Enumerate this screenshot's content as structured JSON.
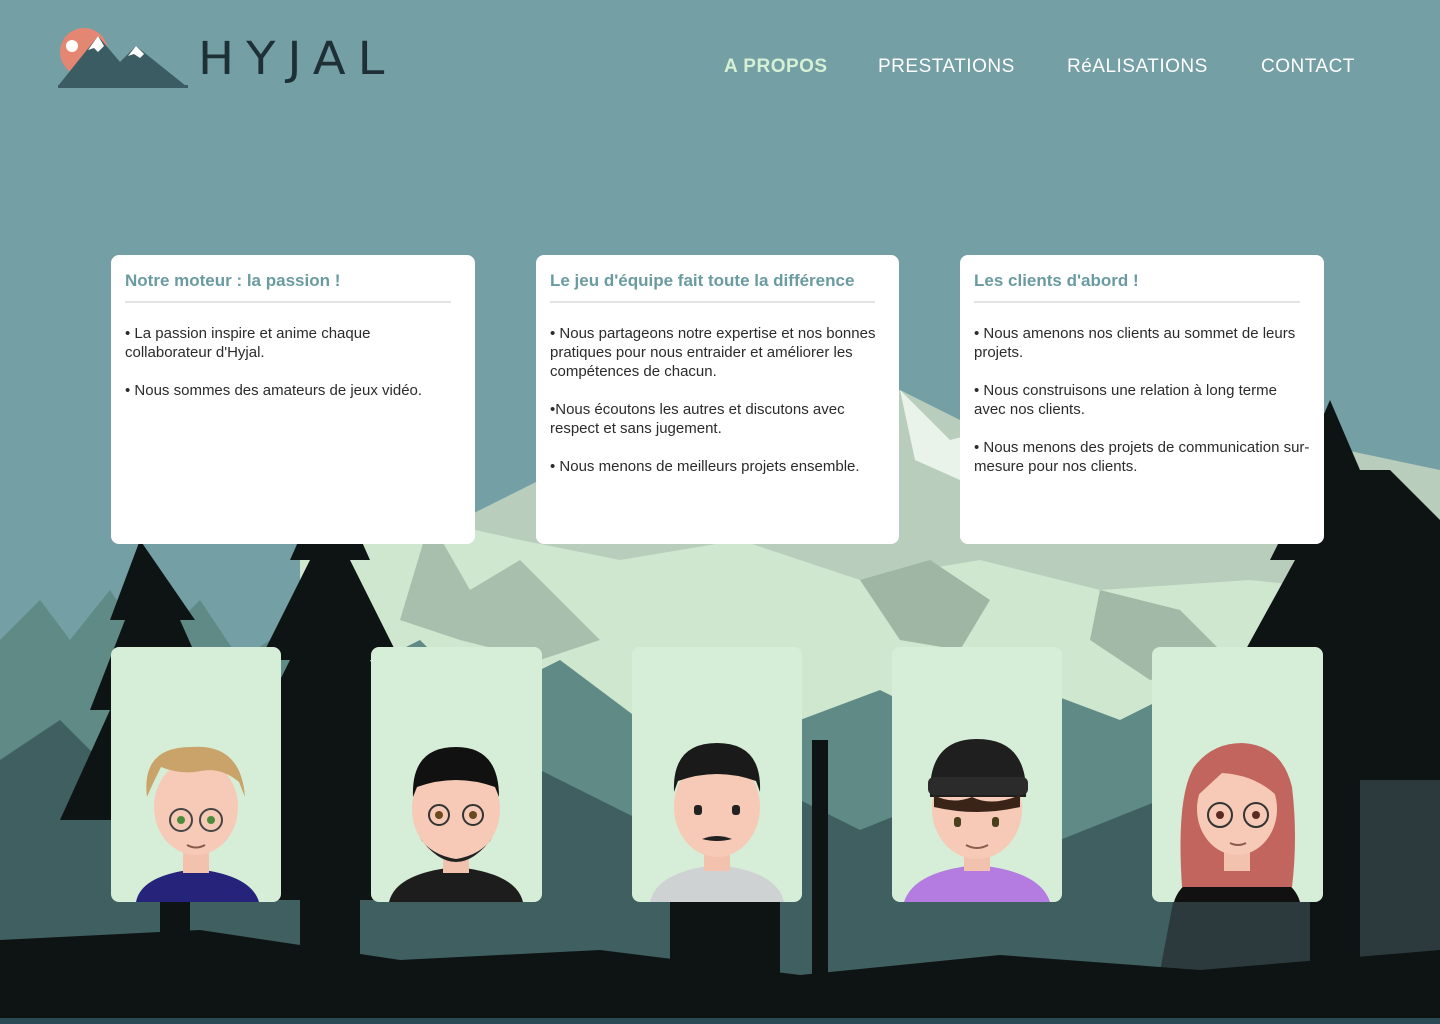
{
  "brand": {
    "name": "HYJAL"
  },
  "nav": {
    "items": [
      {
        "label": "A PROPOS",
        "active": true
      },
      {
        "label": "PRESTATIONS",
        "active": false
      },
      {
        "label": "RéALISATIONS",
        "active": false
      },
      {
        "label": "CONTACT",
        "active": false
      }
    ]
  },
  "values": [
    {
      "title": "Notre moteur : la passion !",
      "lines": [
        "• La passion inspire et anime chaque collaborateur d'Hyjal.",
        "• Nous sommes des amateurs de jeux vidéo."
      ]
    },
    {
      "title": "Le jeu d'équipe fait toute la différence",
      "lines": [
        "• Nous partageons notre expertise et nos bonnes pratiques pour nous entraider et améliorer les compétences de chacun.",
        "•Nous écoutons les autres et discutons avec respect et sans  jugement.",
        "• Nous menons de meilleurs projets ensemble."
      ]
    },
    {
      "title": "Les clients d'abord !",
      "lines": [
        "• Nous amenons nos clients au sommet de leurs projets.",
        "• Nous construisons une relation à long terme avec nos clients.",
        "• Nous menons des projets de communication sur-mesure pour nos clients."
      ]
    }
  ],
  "team": [
    {
      "avatar": "blond-glasses-avatar",
      "shirt": "#26237a",
      "hair": "#c9a36a"
    },
    {
      "avatar": "bearded-glasses-avatar",
      "shirt": "#1d1d1d",
      "hair": "#111111"
    },
    {
      "avatar": "mustache-avatar",
      "shirt": "#cfd2d2",
      "hair": "#1a1a1a"
    },
    {
      "avatar": "beanie-avatar",
      "shirt": "#b47be0",
      "hair": "#3a2418"
    },
    {
      "avatar": "red-hair-glasses-avatar",
      "shirt": "#111111",
      "hair": "#c2655e"
    }
  ],
  "colors": {
    "sky": "#749fa4",
    "accent": "#6a9ba0",
    "nav_active": "#d6f0d6",
    "card_avatar_bg": "#d6eed8"
  }
}
